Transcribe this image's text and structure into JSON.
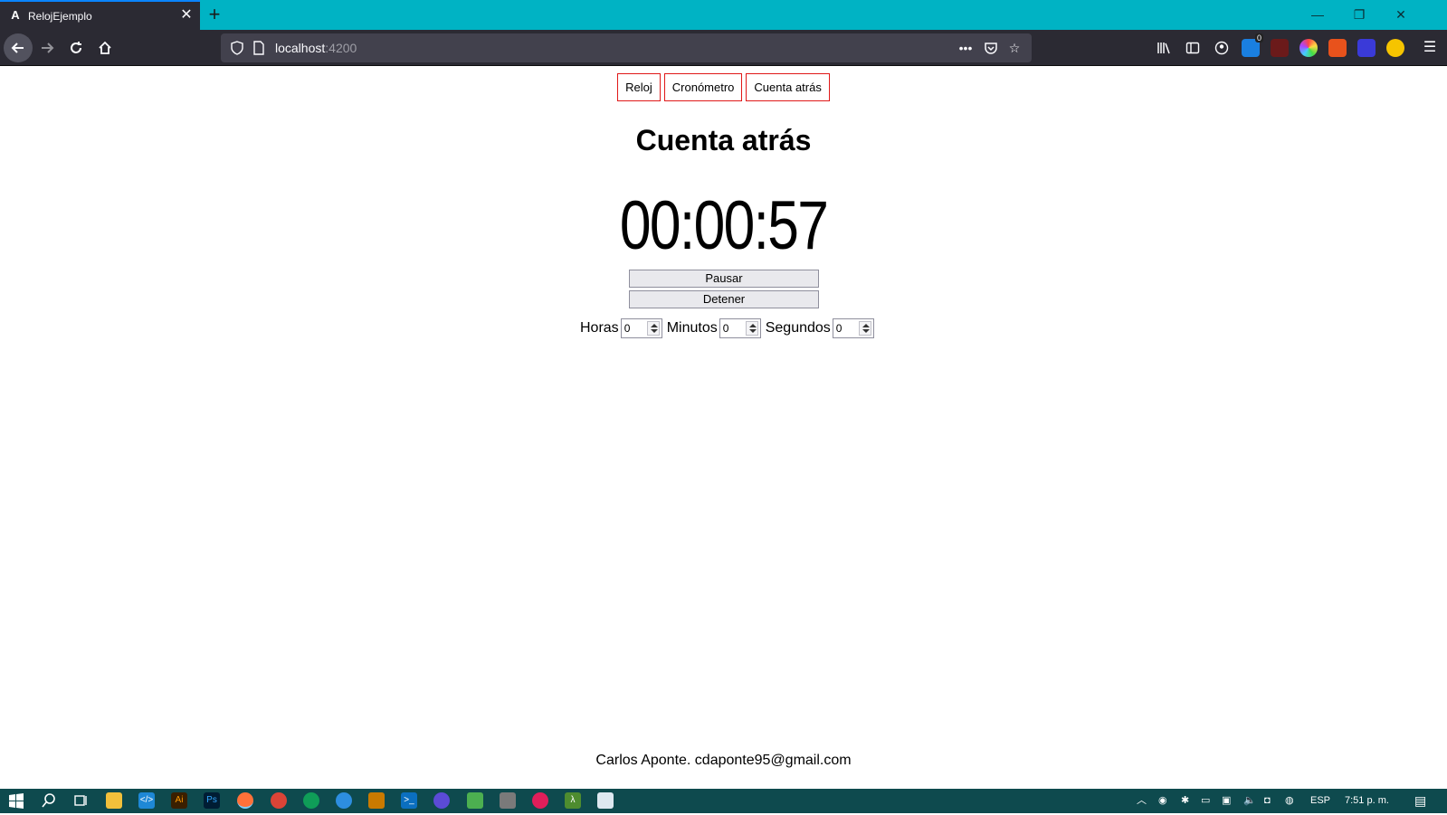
{
  "browser": {
    "tab_title": "RelojEjemplo",
    "tab_favicon": "A",
    "url_host": "localhost",
    "url_port": ":4200",
    "colors": {
      "tabbar": "#00b3c4",
      "toolbar": "#2b2a33",
      "urlbar": "#42414d"
    }
  },
  "nav": {
    "links": [
      "Reloj",
      "Cronómetro",
      "Cuenta atrás"
    ]
  },
  "main": {
    "title": "Cuenta atrás",
    "timer": "00:00:57",
    "pause_label": "Pausar",
    "stop_label": "Detener",
    "fields": [
      {
        "label": "Horas",
        "value": "0"
      },
      {
        "label": "Minutos",
        "value": "0"
      },
      {
        "label": "Segundos",
        "value": "0"
      }
    ],
    "accent_border": "#e01818"
  },
  "footer": {
    "text": "Carlos Aponte. cdaponte95@gmail.com"
  },
  "taskbar": {
    "language": "ESP",
    "clock": "7:51 p. m.",
    "notification_badge": "0",
    "colors": {
      "background": "#0e4a4e"
    }
  }
}
